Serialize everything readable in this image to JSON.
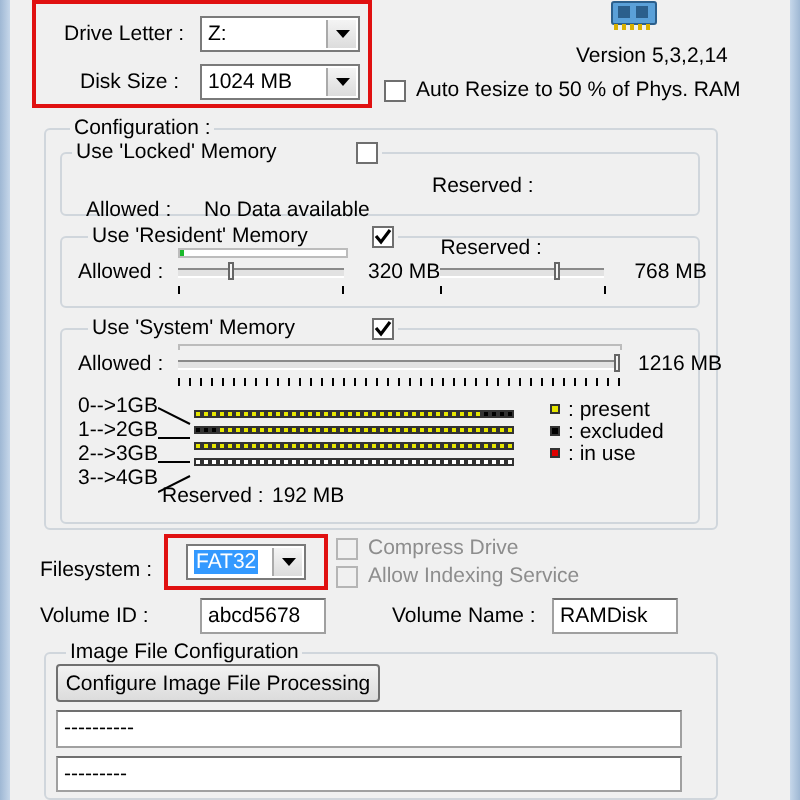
{
  "drive_letter": {
    "label": "Drive Letter :",
    "value": "Z:"
  },
  "disk_size": {
    "label": "Disk Size :",
    "value": "1024 MB"
  },
  "version": "Version  5,3,2,14",
  "auto_resize": {
    "label": "Auto Resize to  50 % of Phys. RAM",
    "checked": false
  },
  "configuration": {
    "title": "Configuration :",
    "locked": {
      "title": "Use 'Locked' Memory",
      "checked": false,
      "reserved_label": "Reserved :",
      "allowed_label": "Allowed :",
      "allowed_value": "No Data available"
    },
    "resident": {
      "title": "Use 'Resident' Memory",
      "checked": true,
      "usage": {
        "level": 0.02
      },
      "allowed_label": "Allowed :",
      "allowed_slider": {
        "level": 0.32
      },
      "allowed_value": "320 MB",
      "reserved_label": "Reserved :",
      "reserved_slider": {
        "level": 0.72
      },
      "reserved_value": "768 MB"
    },
    "system": {
      "title": "Use 'System' Memory",
      "checked": true,
      "allowed_label": "Allowed :",
      "allowed_slider": {
        "level": 1
      },
      "allowed_value": "1216 MB",
      "memory_rows": [
        {
          "label": "0-->1GB"
        },
        {
          "label": "1-->2GB"
        },
        {
          "label": "2-->3GB"
        },
        {
          "label": "3-->4GB"
        }
      ],
      "legend": [
        {
          "label": ": present",
          "color": "#e6e600"
        },
        {
          "label": ": excluded",
          "color": "#000000"
        },
        {
          "label": ": in use",
          "color": "#e00000"
        }
      ],
      "reserved_label": "Reserved :",
      "reserved_value": "192 MB"
    }
  },
  "filesystem": {
    "label": "Filesystem :",
    "value": "FAT32",
    "focused": true
  },
  "options": [
    {
      "label": "Compress Drive",
      "checked": false,
      "disabled": true
    },
    {
      "label": "Allow Indexing Service",
      "checked": false,
      "disabled": true
    }
  ],
  "volume_id": {
    "label": "Volume ID :",
    "value": "abcd5678"
  },
  "volume_name": {
    "label": "Volume Name :",
    "value": "RAMDisk"
  },
  "image_file": {
    "title": "Image File Configuration",
    "button": "Configure Image File Processing",
    "fields": [
      "----------",
      "---------"
    ]
  }
}
